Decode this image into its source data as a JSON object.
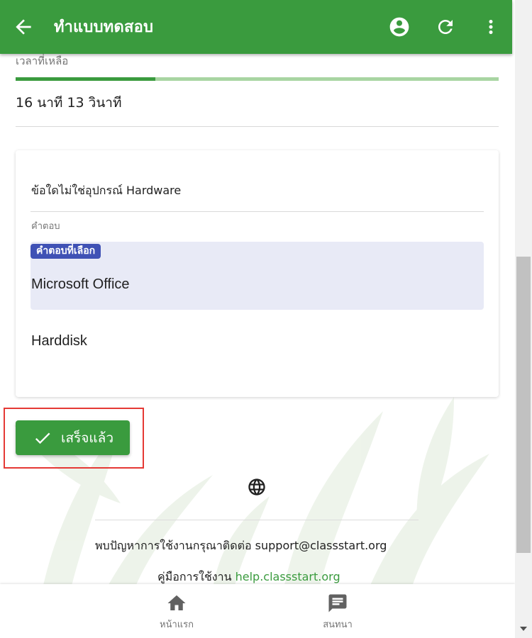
{
  "appbar": {
    "title": "ทำแบบทดสอบ",
    "icons": [
      "back-arrow-icon",
      "account-circle-icon",
      "refresh-icon",
      "more-vert-icon"
    ],
    "color": "#3a9b3e"
  },
  "timer": {
    "label": "เวลาที่เหลือ",
    "value": "16 นาที 13 วินาที",
    "progress_fraction": 0.29
  },
  "question": {
    "text": "ข้อใดไม่ใช่อุปกรณ์ Hardware",
    "answer_label": "คำตอบ",
    "selected_chip": "คำตอบที่เลือก",
    "options": [
      {
        "text": "Microsoft Office",
        "selected": true
      },
      {
        "text": "Harddisk",
        "selected": false
      }
    ]
  },
  "done_button": {
    "label": "เสร็จแล้ว"
  },
  "footer": {
    "support_text": "พบปัญหาการใช้งานกรุณาติดต่อ support@classstart.org",
    "manual_prefix": "คู่มือการใช้งาน ",
    "manual_link": "help.classstart.org"
  },
  "bottom_nav": {
    "home_label": "หน้าแรก",
    "chat_label": "สนทนา"
  },
  "colors": {
    "primary": "#3a9b3e",
    "chip": "#3f51b5",
    "selected_bg": "#e8eaf6",
    "highlight": "#e53935"
  }
}
